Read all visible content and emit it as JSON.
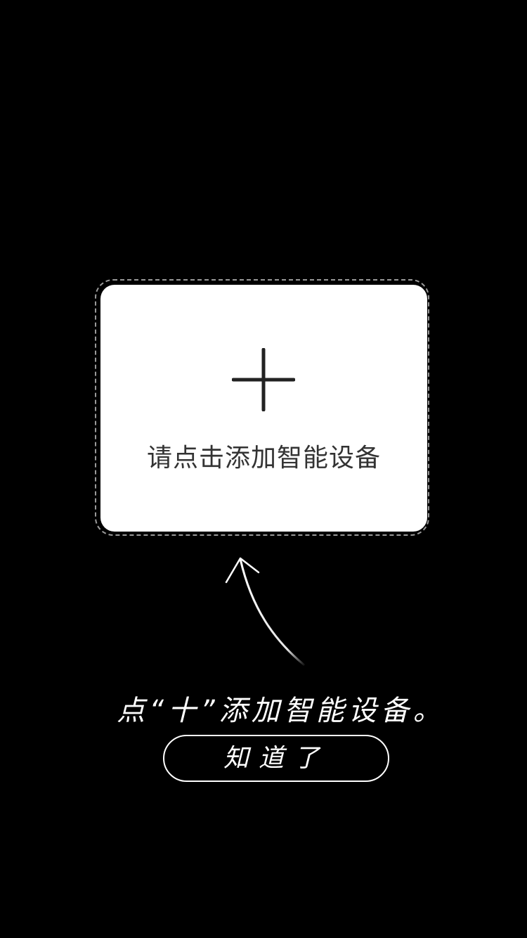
{
  "card": {
    "label": "请点击添加智能设备",
    "icon": "plus-icon"
  },
  "guide": {
    "arrow_icon": "curved-arrow-up-icon",
    "hint": "点“十”添加智能设备。",
    "button_label": "知道了"
  },
  "colors": {
    "background": "#000000",
    "card": "#ffffff",
    "card_text": "#333333",
    "overlay_text": "#ffffff"
  }
}
